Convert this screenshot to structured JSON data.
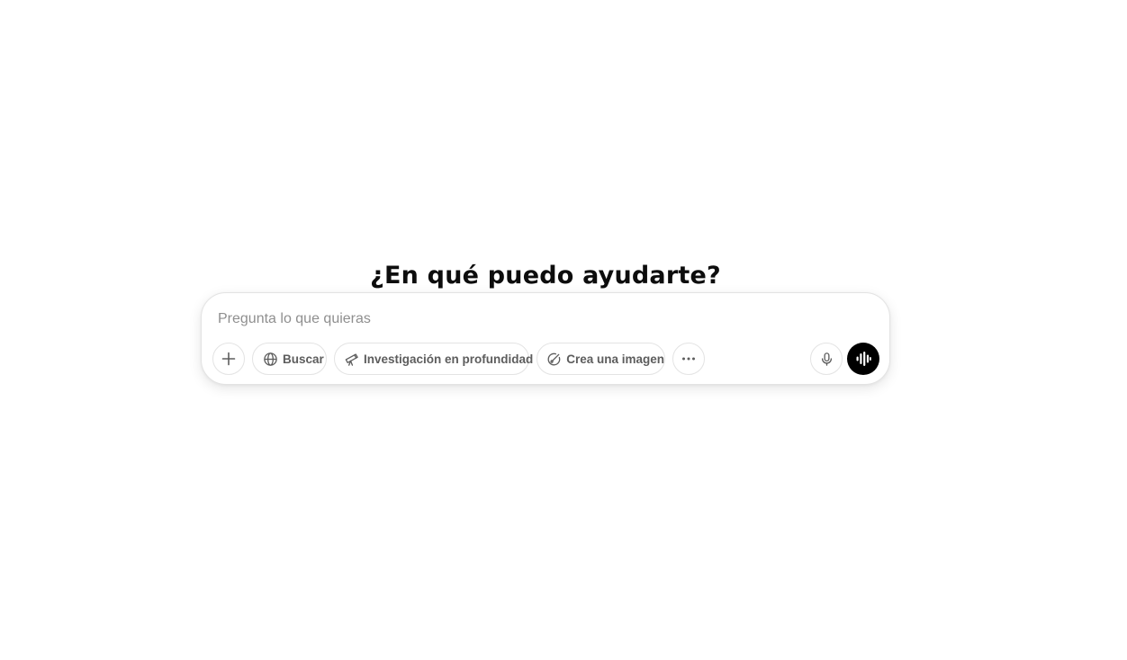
{
  "hero": {
    "title": "¿En qué puedo ayudarte?"
  },
  "composer": {
    "placeholder": "Pregunta lo que quieras",
    "value": ""
  },
  "toolbar": {
    "attach": {
      "icon": "plus-icon"
    },
    "search": {
      "label": "Buscar",
      "icon": "globe-icon"
    },
    "deep_research": {
      "label": "Investigación en profundidad",
      "icon": "telescope-icon"
    },
    "create_image": {
      "label": "Crea una imagen",
      "icon": "image-brush-icon"
    },
    "more": {
      "icon": "more-dots-icon"
    },
    "dictate": {
      "icon": "microphone-icon"
    },
    "voice_mode": {
      "icon": "waveform-icon"
    }
  },
  "colors": {
    "background": "#ffffff",
    "text": "#0d0d0d",
    "muted": "#5d5d5d",
    "placeholder": "#8f8f8f",
    "border": "#e3e3e3",
    "voice_button": "#000000"
  }
}
